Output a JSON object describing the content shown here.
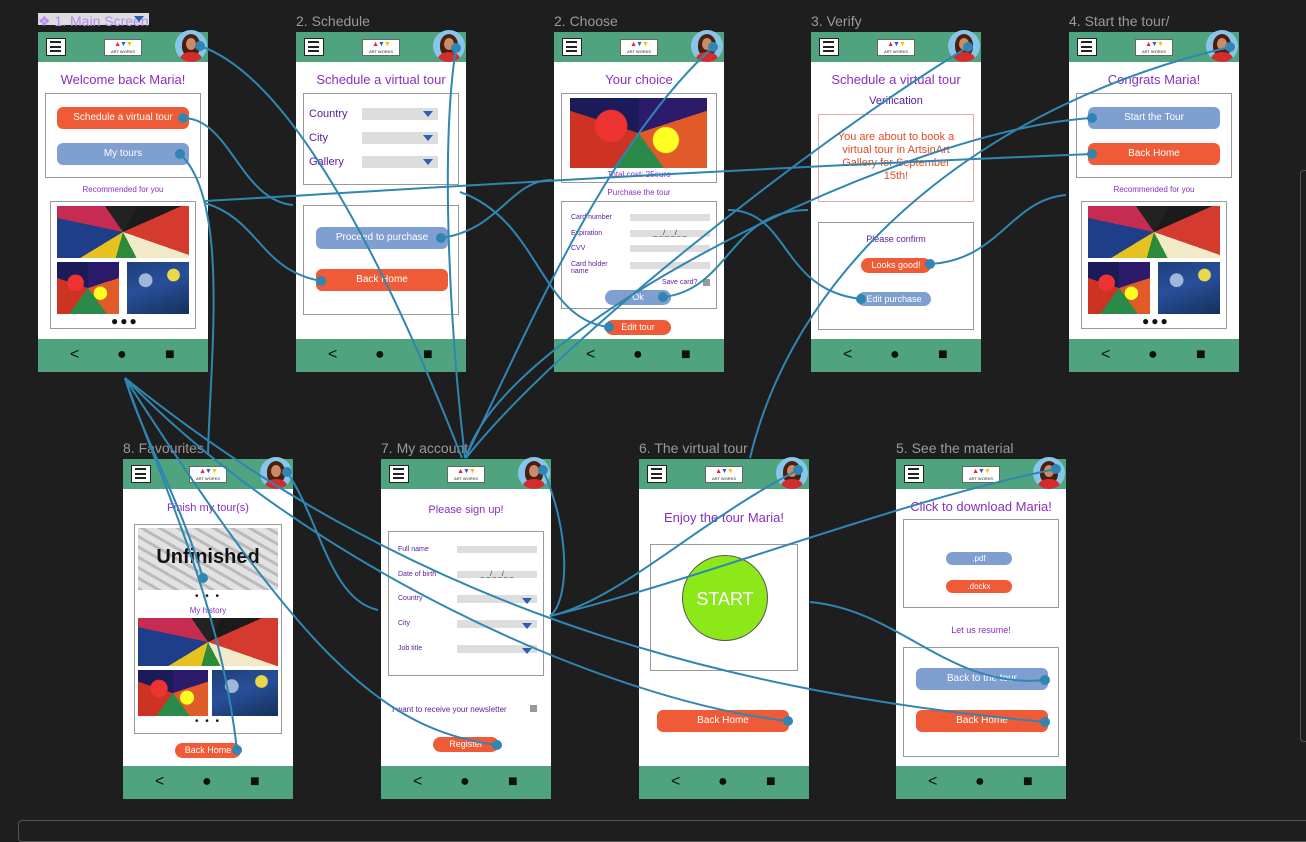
{
  "logo_text": "ART WORKS",
  "frames": {
    "f1": {
      "label": "1. Main Screen",
      "title": "Welcome back Maria!",
      "btn_schedule": "Schedule a virtual tour",
      "btn_mytours": "My tours",
      "recommended": "Recommended for you",
      "dots": "●●●"
    },
    "f2": {
      "label": "2. Schedule",
      "title": "Schedule a virtual tour",
      "country": "Country",
      "city": "City",
      "gallery": "Gallery",
      "btn_proceed": "Proceed to purchase",
      "btn_back": "Back Home"
    },
    "f3": {
      "label": "2. Choose",
      "title": "Your choice",
      "total": "Total cost: 25euro",
      "purchase": "Purchase the tour",
      "card_number": "Card number",
      "expiration": "Expiration",
      "exp_mask": "_ _/_ _/_ _",
      "cvv": "CVV",
      "card_holder": "Card holder name",
      "save_card": "Save card?",
      "btn_ok": "Ok",
      "btn_edit": "Edit tour"
    },
    "f4": {
      "label": "3. Verify",
      "title": "Schedule a virtual tour",
      "subtitle": "Verification",
      "message": "You are about to book a virtual tour in ArtsinArt Gallery for September 15th!",
      "confirm": "Please confirm",
      "btn_good": "Looks good!",
      "btn_edit": "Edit purchase"
    },
    "f5": {
      "label": "4. Start the tour/",
      "title": "Congrats Maria!",
      "btn_start": "Start the Tour",
      "btn_back": "Back Home",
      "recommended": "Recommended for you",
      "dots": "●●●"
    },
    "f6": {
      "label": "8. Favourites",
      "title": "Finish my tour(s)",
      "unfinished": "Unfinished",
      "history": "My history",
      "dots": "•   •   •",
      "btn_back": "Back Home"
    },
    "f7": {
      "label": "7. My account",
      "title": "Please sign up!",
      "full_name": "Full name",
      "dob": "Date of birth",
      "dob_mask": "_ _/_ _/_ _",
      "country": "Country",
      "city": "City",
      "job": "Job title",
      "newsletter": "I want to receive your newsletter",
      "btn_register": "Register"
    },
    "f8": {
      "label": "6. The virtual tour",
      "title": "Enjoy the tour Maria!",
      "btn_start": "START",
      "btn_back": "Back Home"
    },
    "f9": {
      "label": "5. See the material",
      "title": "Click to download Maria!",
      "pdf": ".pdf",
      "docx": ".dockx",
      "resume": "Let us resume!",
      "btn_tour": "Back to the tour",
      "btn_back": "Back Home"
    }
  },
  "nav": {
    "back": "<",
    "home": "●",
    "recent": "■"
  },
  "colors": {
    "green": "#4fa37f",
    "orange": "#ef5b36",
    "blue": "#7e9fd0",
    "purple": "#8a2ec0",
    "wire": "#2f86b2",
    "canvas": "#1e1e1e"
  }
}
